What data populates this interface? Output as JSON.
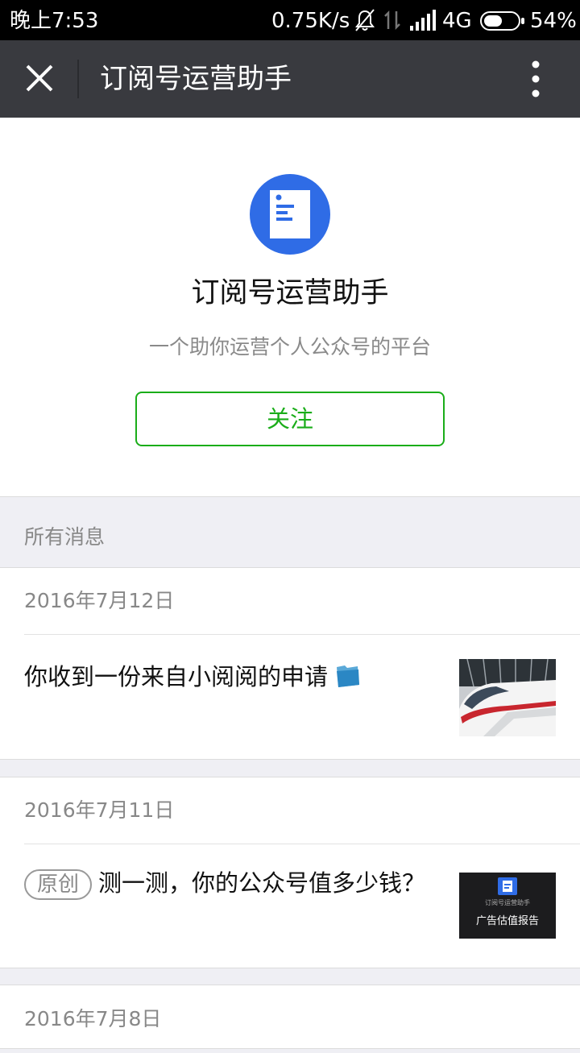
{
  "status_bar": {
    "time": "晚上7:53",
    "speed": "0.75K/s",
    "network": "4G",
    "battery_percent": "54%",
    "battery_level": 0.54
  },
  "nav": {
    "title": "订阅号运营助手"
  },
  "profile": {
    "name": "订阅号运营助手",
    "description": "一个助你运营个人公众号的平台",
    "follow_label": "关注"
  },
  "section_label": "所有消息",
  "messages": [
    {
      "date": "2016年7月12日",
      "title": "你收到一份来自小阅阅的申请",
      "title_icon": "folder-icon",
      "thumb": "train-image"
    },
    {
      "date": "2016年7月11日",
      "tag": "原创",
      "title": "测一测，你的公众号值多少钱？",
      "thumb_text": "广告估值报告",
      "thumb_small_text": "订阅号运营助手"
    },
    {
      "date": "2016年7月8日"
    }
  ],
  "colors": {
    "accent_green": "#1aad19",
    "nav_bg": "#393a3f",
    "avatar_blue": "#2f6ce6"
  }
}
